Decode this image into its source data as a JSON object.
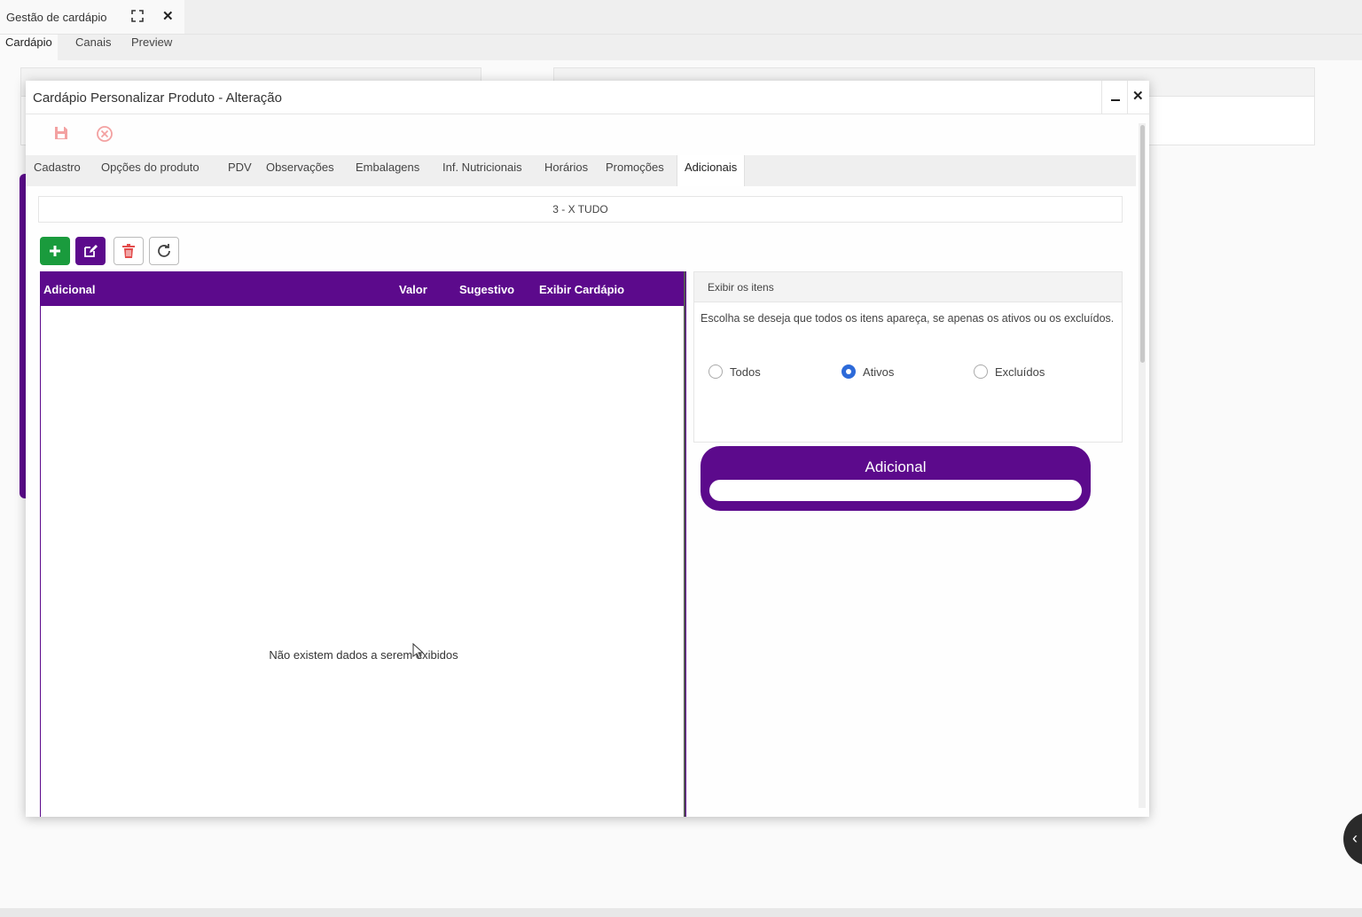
{
  "app_tab": {
    "title": "Gestão de cardápio",
    "expand_icon": "expand-icon",
    "close_icon": "close-icon"
  },
  "subnav": {
    "items": [
      "Cardápio",
      "Canais",
      "Preview"
    ],
    "active": "Cardápio"
  },
  "modal": {
    "title": "Cardápio Personalizar Produto - Alteração",
    "toolbar": {
      "save_icon": "save-icon",
      "cancel_icon": "cancel-icon"
    },
    "tabs": [
      "Cadastro",
      "Opções do produto",
      "PDV",
      "Observações",
      "Embalagens",
      "Inf. Nutricionais",
      "Horários",
      "Promoções",
      "Adicionais"
    ],
    "active_tab": "Adicionais",
    "product": "3 - X TUDO",
    "actions": [
      "add-icon",
      "edit-icon",
      "trash-icon",
      "refresh-icon"
    ],
    "grid": {
      "columns": [
        "Adicional",
        "Valor",
        "Sugestivo",
        "Exibir Cardápio"
      ],
      "rows": [],
      "empty_message": "Não existem dados a serem exibidos"
    },
    "filter": {
      "title": "Exibir os itens",
      "description": "Escolha se deseja que todos os itens apareça, se apenas os ativos ou os excluídos.",
      "options": [
        "Todos",
        "Ativos",
        "Excluídos"
      ],
      "selected": "Ativos"
    },
    "adicional_card": {
      "label": "Adicional",
      "value": ""
    }
  },
  "colors": {
    "primary": "#5c0a8c",
    "add": "#1a9b3d",
    "delete": "#e34c4c",
    "radio": "#2d6ad9"
  }
}
